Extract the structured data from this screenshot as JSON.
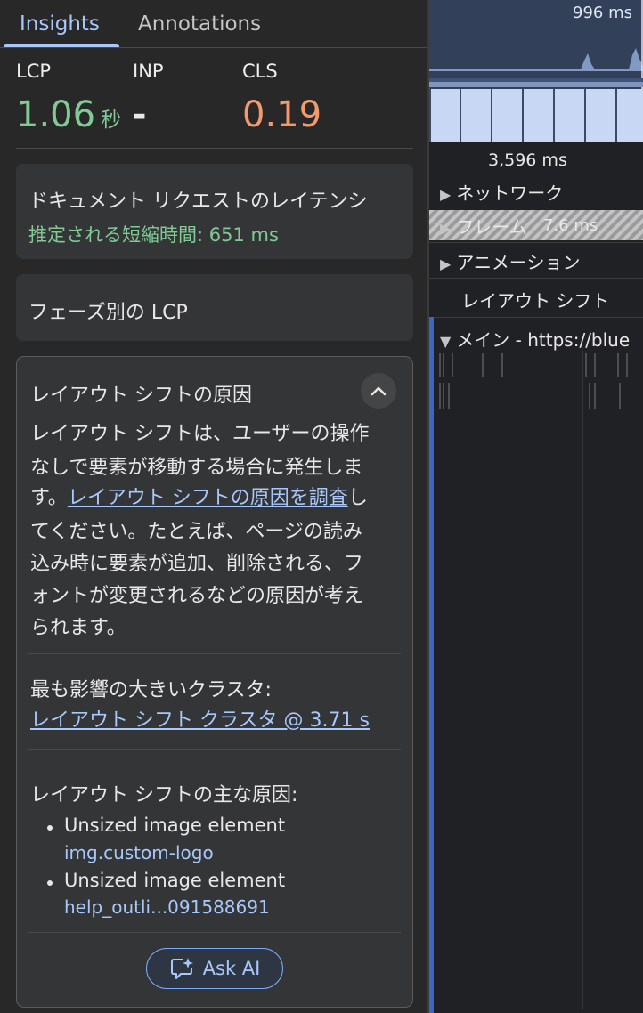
{
  "tabs": [
    {
      "label": "Insights",
      "active": true
    },
    {
      "label": "Annotations",
      "active": false
    }
  ],
  "metrics": [
    {
      "name": "LCP",
      "value": "1.06",
      "unit": "秒",
      "color": "#81c995"
    },
    {
      "name": "INP",
      "value": "-",
      "unit": "",
      "color": "#e8e8e8"
    },
    {
      "name": "CLS",
      "value": "0.19",
      "unit": "",
      "color": "#f29a6e"
    }
  ],
  "cards": {
    "doc_latency": {
      "title": "ドキュメント リクエストのレイテンシ",
      "savings": "推定される短縮時間: 651 ms"
    },
    "lcp_phases": {
      "title": "フェーズ別の LCP"
    },
    "layout_shift": {
      "title": "レイアウト シフトの原因",
      "desc_line1": "レイアウト シフトは、ユーザーの操作",
      "desc_line2": "なしで要素が移動する場合に発生しま",
      "desc_line3_pre": "す。",
      "desc_link": "レイアウト シフトの原因を調査",
      "desc_line3_post": "し",
      "desc_line4": "てください。たとえば、ページの読み",
      "desc_line5": "込み時に要素が追加、削除される、フ",
      "desc_line6": "ォントが変更されるなどの原因が考え",
      "desc_line7": "られます。",
      "worst_cluster_label": "最も影響の大きいクラスタ:",
      "worst_cluster_link": "レイアウト シフト クラスタ @ 3.71 s",
      "causes_label": "レイアウト シフトの主な原因:",
      "causes": [
        {
          "title": "Unsized image element",
          "node": "img.custom-logo"
        },
        {
          "title": "Unsized image element",
          "node": "help_outli...091588691"
        }
      ],
      "ask_ai": "Ask AI"
    }
  },
  "timeline": {
    "overview_time": "996 ms",
    "time_mark": "3,596 ms",
    "frame_duration": "7.6 ms",
    "tracks": [
      {
        "label": "ネットワーク",
        "expanded": false
      },
      {
        "label": "フレーム",
        "expanded": false
      },
      {
        "label": "アニメーション",
        "expanded": false
      },
      {
        "label": "レイアウト シフト",
        "expanded": null
      },
      {
        "label": "メイン - https://blue",
        "expanded": true
      }
    ]
  },
  "colors": {
    "accent": "#a8c7fa",
    "good": "#81c995",
    "needs_improvement": "#f29a6e"
  }
}
